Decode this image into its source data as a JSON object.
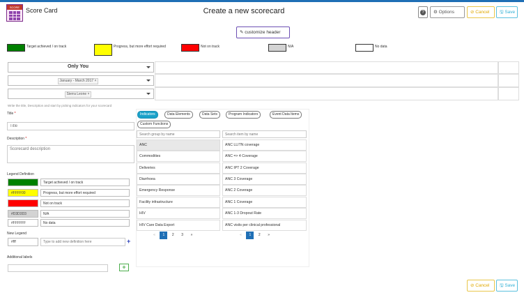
{
  "header": {
    "app_title": "Score Card",
    "logo_caption": "SCORE",
    "page_title": "Create a new scorecard",
    "help_label": "?",
    "options_label": "⚙ Options",
    "cancel_label": "⊘ Cancel",
    "save_label": "🖫 Save",
    "customize_label": "✎ customize header"
  },
  "legend": [
    {
      "color": "#008000",
      "label": "Target achieved / on track"
    },
    {
      "color": "#FFFF00",
      "label": "Progress, but more effort required"
    },
    {
      "color": "#FF0000",
      "label": "Not on track"
    },
    {
      "color": "#D3D3D3",
      "label": "N/A"
    },
    {
      "color": "#FFFFFF",
      "label": "No data"
    }
  ],
  "selectors": {
    "org_unit_mode": "Only You",
    "period": "January - March 2017",
    "org_unit": "Sierra Leone"
  },
  "form": {
    "hint": "Write the title, Description and start by picking indicators for your scorecard",
    "title_label": "Title",
    "title_placeholder": "Title",
    "description_label": "Description",
    "description_placeholder": "Scorecard description",
    "legend_definition_label": "Legend Definition",
    "legend_definitions": [
      {
        "code": "",
        "color": "#008000",
        "label": "Target achieved / on track"
      },
      {
        "code": "#FFFF00",
        "color": "#FFFF00",
        "label": "Progress, but more effort required"
      },
      {
        "code": "",
        "color": "#FF0000",
        "label": "Not on track"
      },
      {
        "code": "#D3D3D3",
        "color": "#D3D3D3",
        "label": "N/A"
      },
      {
        "code": "#FFFFFF",
        "color": "#FFFFFF",
        "label": "No data"
      }
    ],
    "new_legend_label": "New Legend",
    "new_legend_color": "#fff",
    "new_legend_placeholder": "Type to add new definition here",
    "additional_labels_label": "Additional labels"
  },
  "picker": {
    "tabs": [
      "Indicators",
      "Data Elements",
      "Data Sets",
      "Program Indicators",
      "Event Data Items",
      "Custom Functions"
    ],
    "group_search_placeholder": "Search group by name",
    "item_search_placeholder": "Search item by name",
    "groups": [
      "ANC",
      "Commodities",
      "Deliveries",
      "Diarrhoea",
      "Emergency Response",
      "Facility infrastructure",
      "HIV",
      "HIV Care Data Export"
    ],
    "items": [
      "ANC LLITN coverage",
      "ANC => 4 Coverage",
      "ANC IPT 2 Coverage",
      "ANC 3 Coverage",
      "ANC 2 Coverage",
      "ANC 1 Coverage",
      "ANC 1-3 Dropout Rate",
      "ANC visits per clinical professional"
    ],
    "group_pages": [
      "«",
      "1",
      "2",
      "3",
      "»"
    ],
    "item_pages": [
      "«",
      "1",
      "2",
      "»"
    ]
  }
}
